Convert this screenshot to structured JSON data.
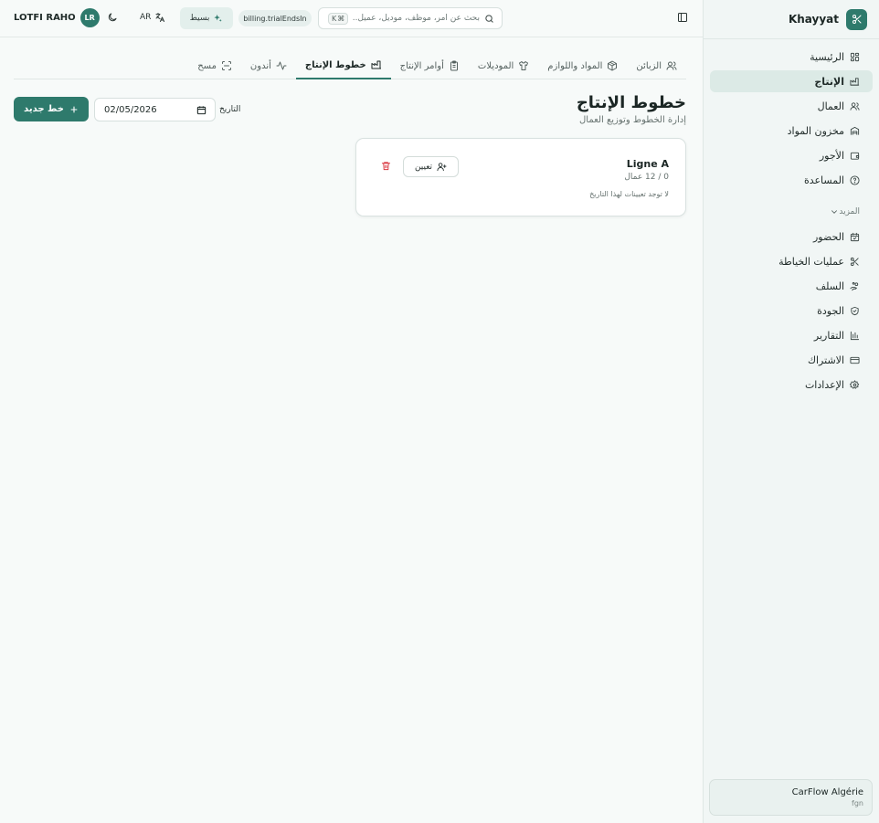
{
  "app": {
    "name": "Khayyat"
  },
  "sidebar": {
    "items": [
      {
        "label": "الرئيسية",
        "icon": "dashboard-icon",
        "active": false
      },
      {
        "label": "الإنتاج",
        "icon": "factory-icon",
        "active": true
      },
      {
        "label": "العمال",
        "icon": "users-icon",
        "active": false
      },
      {
        "label": "مخزون المواد",
        "icon": "warehouse-icon",
        "active": false
      },
      {
        "label": "الأجور",
        "icon": "wallet-icon",
        "active": false
      },
      {
        "label": "المساعدة",
        "icon": "help-icon",
        "active": false
      }
    ],
    "more_label": "المزيد",
    "more_items": [
      {
        "label": "الحضور",
        "icon": "calendar-check-icon"
      },
      {
        "label": "عمليات الخياطة",
        "icon": "scissors-icon"
      },
      {
        "label": "السلف",
        "icon": "hand-coins-icon"
      },
      {
        "label": "الجودة",
        "icon": "shield-check-icon"
      },
      {
        "label": "التقارير",
        "icon": "bar-chart-icon"
      },
      {
        "label": "الاشتراك",
        "icon": "credit-card-icon"
      },
      {
        "label": "الإعدادات",
        "icon": "gear-icon"
      }
    ],
    "org": {
      "name": "CarFlow Algérie",
      "code": "fgn"
    }
  },
  "topbar": {
    "user_name": "LOTFI RAHO",
    "avatar_initials": "LR",
    "lang": "AR",
    "plan": "بسيط",
    "trial": "billing.trialEndsIn",
    "search_placeholder": "بحث عن أمر، موظف، موديل، عميل...",
    "shortcut_key": "K",
    "shortcut_mod": "⌘"
  },
  "tabs": [
    {
      "label": "الزبائن",
      "icon": "users-icon",
      "active": false
    },
    {
      "label": "المواد واللوازم",
      "icon": "package-icon",
      "active": false
    },
    {
      "label": "الموديلات",
      "icon": "shirt-icon",
      "active": false
    },
    {
      "label": "أوامر الإنتاج",
      "icon": "clipboard-icon",
      "active": false
    },
    {
      "label": "خطوط الإنتاج",
      "icon": "factory-icon",
      "active": true
    },
    {
      "label": "أندون",
      "icon": "activity-icon",
      "active": false
    },
    {
      "label": "مسح",
      "icon": "scan-icon",
      "active": false
    }
  ],
  "page": {
    "title": "خطوط الإنتاج",
    "subtitle": "إدارة الخطوط وتوزيع العمال",
    "date_label": "التاريخ",
    "date_value": "02/05/2026",
    "new_button": "خط جديد"
  },
  "lines": [
    {
      "name": "Ligne A",
      "count": "0 / 12 عمال",
      "empty_text": "لا توجد تعيينات لهذا التاريخ",
      "assign_label": "تعيين"
    }
  ],
  "colors": {
    "primary": "#2e7a6c",
    "danger": "#d9363e",
    "active_bg": "#dceae6"
  }
}
